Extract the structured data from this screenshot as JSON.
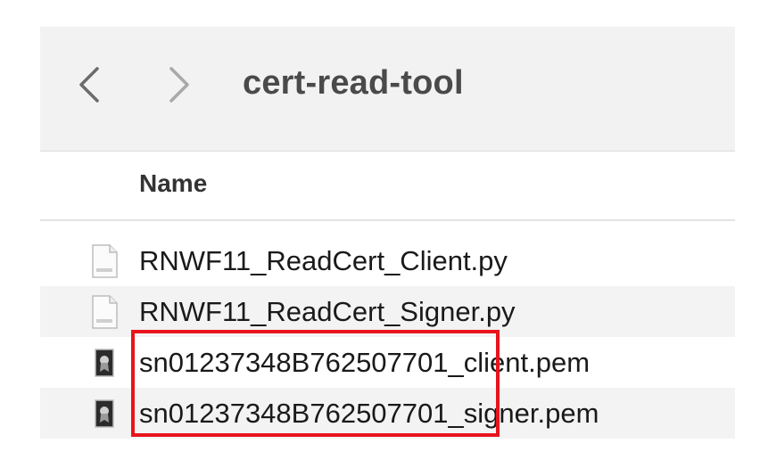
{
  "window": {
    "folder_title": "cert-read-tool",
    "nav_back_icon": "chevron-left-icon",
    "nav_forward_icon": "chevron-right-icon"
  },
  "list": {
    "column_header": "Name",
    "files": [
      {
        "name": "RNWF11_ReadCert_Client.py",
        "icon": "python-file-icon"
      },
      {
        "name": "RNWF11_ReadCert_Signer.py",
        "icon": "python-file-icon"
      },
      {
        "name": "sn01237348B762507701_client.pem",
        "icon": "certificate-file-icon"
      },
      {
        "name": "sn01237348B762507701_signer.pem",
        "icon": "certificate-file-icon"
      }
    ]
  },
  "annotation": {
    "highlight_color": "#e8141c"
  }
}
